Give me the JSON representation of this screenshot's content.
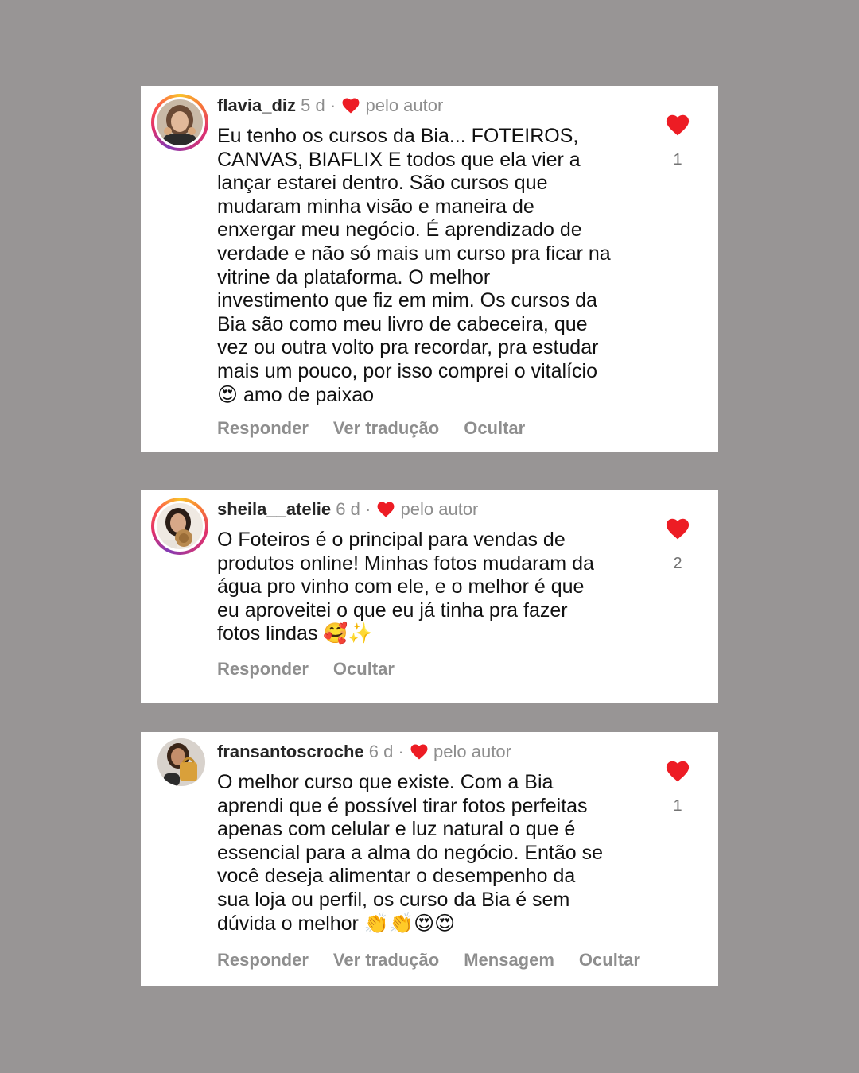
{
  "colors": {
    "background": "#989595",
    "heart": "#ed1c24",
    "secondary_text": "#8e8e8e"
  },
  "comments": [
    {
      "username": "flavia_diz",
      "time": "5 d",
      "liked_by": "pelo autor",
      "text": "Eu tenho os cursos da Bia... FOTEIROS,\nCANVAS, BIAFLIX E todos que ela vier a\nlançar estarei dentro. São cursos que\nmudaram minha visão e maneira de\nenxergar meu negócio. É aprendizado de\nverdade e não só mais um curso pra ficar na\nvitrine da plataforma. O melhor\ninvestimento que fiz em mim. Os cursos da\nBia são como meu livro de cabeceira, que\nvez ou outra volto pra recordar, pra estudar\nmais um pouco, por isso comprei o vitalício\n😍 amo de paixao",
      "actions": [
        "Responder",
        "Ver tradução",
        "Ocultar"
      ],
      "likes": "1"
    },
    {
      "username": "sheila__atelie",
      "time": "6 d",
      "liked_by": "pelo autor",
      "text": "O Foteiros é o principal para vendas de\nprodutos online! Minhas fotos mudaram da\nágua pro vinho com ele, e o melhor é que\neu aproveitei o que eu já tinha pra fazer\nfotos lindas 🥰✨",
      "actions": [
        "Responder",
        "Ocultar"
      ],
      "likes": "2"
    },
    {
      "username": "fransantoscroche",
      "time": "6 d",
      "liked_by": "pelo autor",
      "text": "O melhor curso que existe. Com a Bia\naprendi que é possível tirar fotos perfeitas\napenas com celular e luz natural o que é\nessencial para a alma do negócio. Então se\nvocê deseja alimentar o desempenho da\nsua loja ou perfil, os curso da Bia é sem\ndúvida o melhor 👏👏😍😍",
      "actions": [
        "Responder",
        "Ver tradução",
        "Mensagem",
        "Ocultar"
      ],
      "likes": "1"
    }
  ]
}
